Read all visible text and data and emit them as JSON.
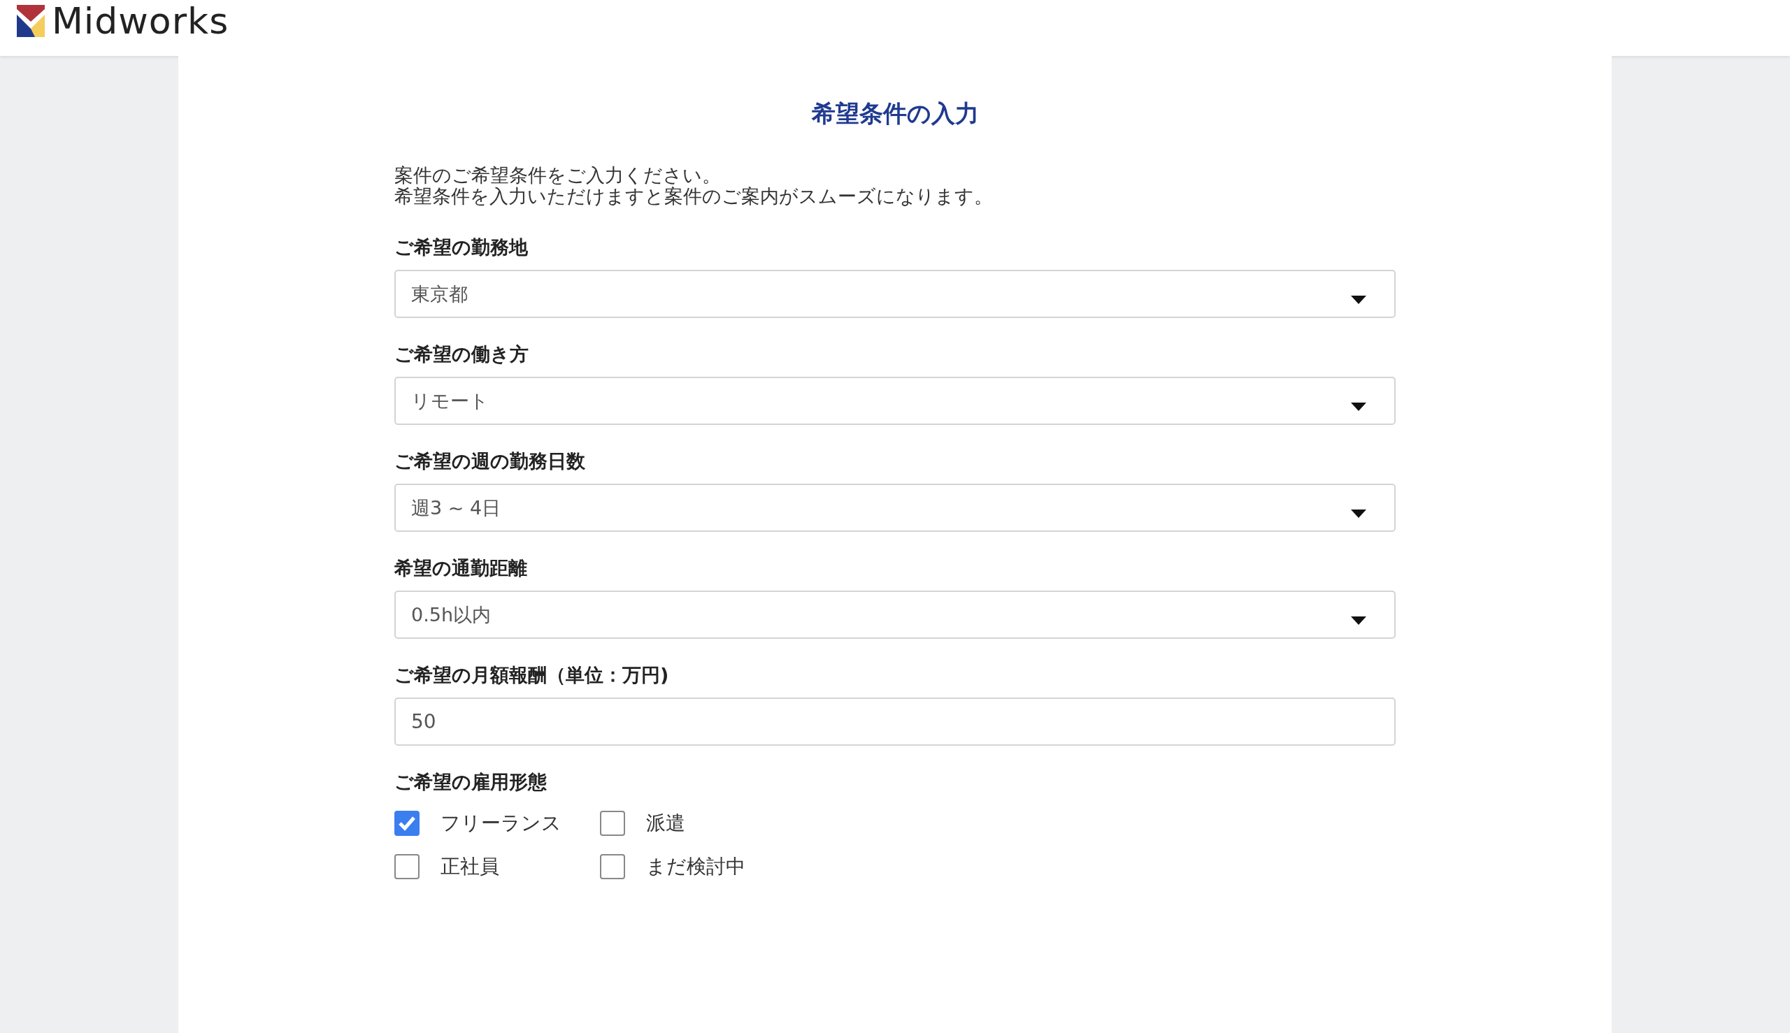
{
  "header": {
    "logo_text": "Midworks"
  },
  "form": {
    "title": "希望条件の入力",
    "description": [
      "案件のご希望条件をご入力ください。",
      "希望条件を入力いただけますと案件のご案内がスムーズになります。"
    ],
    "fields": [
      {
        "kind": "select",
        "label": "ご希望の勤務地",
        "value": "東京都"
      },
      {
        "kind": "select",
        "label": "ご希望の働き方",
        "value": "リモート"
      },
      {
        "kind": "select",
        "label": "ご希望の週の勤務日数",
        "value": "週3 ~ 4日"
      },
      {
        "kind": "select",
        "label": "希望の通勤距離",
        "value": "0.5h以内"
      },
      {
        "kind": "text",
        "label": "ご希望の月額報酬（単位：万円)",
        "value": "50"
      }
    ],
    "employment": {
      "label": "ご希望の雇用形態",
      "options": [
        {
          "label": "フリーランス",
          "checked": true
        },
        {
          "label": "派遣",
          "checked": false
        },
        {
          "label": "正社員",
          "checked": false
        },
        {
          "label": "まだ検討中",
          "checked": false
        }
      ]
    }
  }
}
